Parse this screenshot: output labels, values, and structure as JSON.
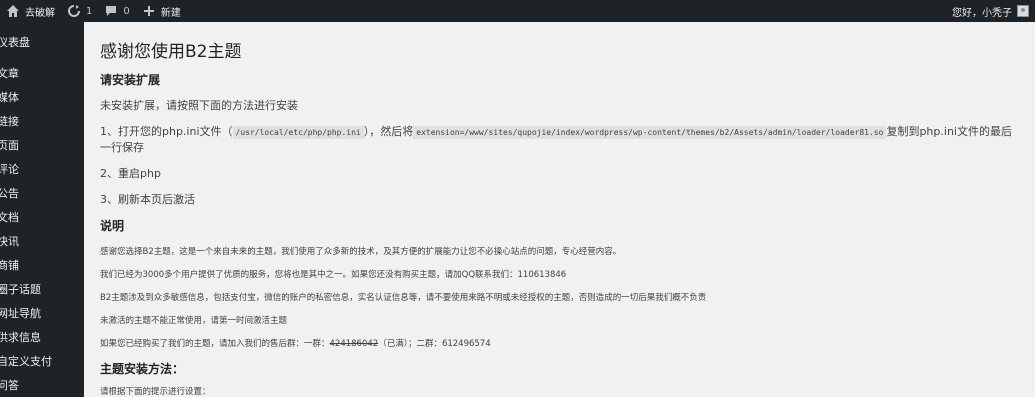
{
  "adminbar": {
    "site_name": "去破解",
    "updates_count": "1",
    "comments_count": "0",
    "new_label": "新建",
    "greeting": "您好，小秃子"
  },
  "sidebar": {
    "items": [
      {
        "label": "仪表盘"
      },
      {
        "label": "文章"
      },
      {
        "label": "媒体"
      },
      {
        "label": "链接"
      },
      {
        "label": "页面"
      },
      {
        "label": "评论"
      },
      {
        "label": "公告"
      },
      {
        "label": "文档"
      },
      {
        "label": "快讯"
      },
      {
        "label": "商铺"
      },
      {
        "label": "圈子话题"
      },
      {
        "label": "网址导航"
      },
      {
        "label": "供求信息"
      },
      {
        "label": "自定义支付"
      },
      {
        "label": "问答"
      }
    ]
  },
  "main": {
    "title": "感谢您使用B2主题",
    "install_heading": "请安装扩展",
    "not_installed_text": "未安装扩展，请按照下面的方法进行安装",
    "step1_prefix": "1、打开您的php.ini文件（",
    "step1_code1": "/usr/local/etc/php/php.ini",
    "step1_mid": "），然后将",
    "step1_code2": "extension=/www/sites/qupojie/index/wordpress/wp-content/themes/b2/Assets/admin/loader/loader81.so",
    "step1_suffix": "复制到php.ini文件的最后",
    "step1_line2": "一行保存",
    "step2": "2、重启php",
    "step3": "3、刷新本页后激活",
    "notes_heading": "说明",
    "note1": "感谢您选择B2主题，这是一个来自未来的主题，我们使用了众多新的技术，及其方便的扩展能力让您不必操心站点的问题，专心经营内容。",
    "note2": "我们已经为3000多个用户提供了优质的服务，您将也是其中之一。如果您还没有购买主题，请加QQ联系我们：110613846",
    "note3": "B2主题涉及到众多敏感信息，包括支付宝，微信的账户的私密信息，实名认证信息等，请不要使用来路不明或未经授权的主题，否则造成的一切后果我们概不负责",
    "note4": "未激活的主题不能正常使用，请第一时间激活主题",
    "note5_prefix": "如果您已经购买了我们的主题，请加入我们的售后群：一群：",
    "note5_group1": "424186042",
    "note5_mid": "（已满）；二群：612496574",
    "method_heading": "主题安装方法：",
    "method_text": "请根据下面的提示进行设置："
  }
}
